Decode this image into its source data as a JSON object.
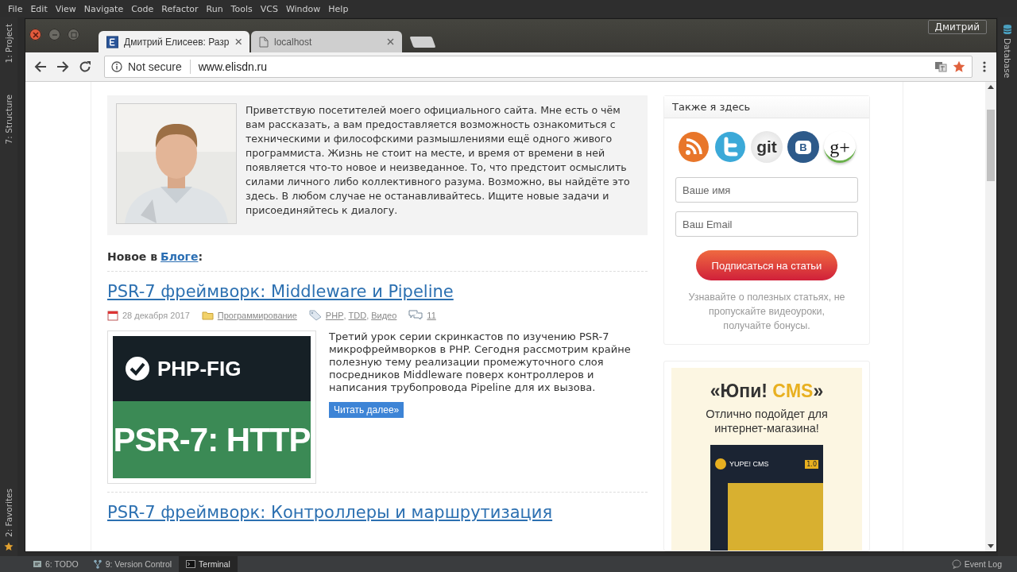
{
  "ide": {
    "menu": [
      "File",
      "Edit",
      "View",
      "Navigate",
      "Code",
      "Refactor",
      "Run",
      "Tools",
      "VCS",
      "Window",
      "Help"
    ],
    "left_tools": [
      {
        "label": "1: Project",
        "kind": "project"
      },
      {
        "label": "7: Structure",
        "kind": "structure"
      },
      {
        "label": "2: Favorites",
        "kind": "favorites"
      }
    ],
    "right_tools": [
      {
        "label": "Database"
      }
    ],
    "status_bar": [
      {
        "label": "6: TODO",
        "kind": "todo",
        "selected": false
      },
      {
        "label": "9: Version Control",
        "kind": "vcs",
        "selected": false
      },
      {
        "label": "Terminal",
        "kind": "terminal",
        "selected": true
      }
    ],
    "event_log": "Event Log"
  },
  "browser": {
    "profile": "Дмитрий",
    "tabs": [
      {
        "title": "Дмитрий Елисеев: Разр",
        "kind": "site",
        "selected": true
      },
      {
        "title": "localhost",
        "kind": "page",
        "selected": false
      }
    ],
    "security": "Not secure",
    "url": "www.elisdn.ru"
  },
  "page": {
    "intro": "Приветствую посетителей моего официального сайта. Мне есть о чём вам рассказать, а вам предоставляется возможность ознакомиться с техническими и философскими размышлениями ещё одного живого программиста. Жизнь не стоит на месте, и время от времени в ней появляется что-то новое и неизведанное. То, что предстоит осмыслить силами личного либо коллективного разума. Возможно, вы найдёте это здесь. В любом случае не останавливайтесь. Ищите новые задачи и присоединяйтесь к диалогу.",
    "news_label": "Новое в",
    "news_link": "Блоге",
    "news_colon": ":",
    "post": {
      "title": "PSR-7 фреймворк: Middleware и Pipeline",
      "date": "28 декабря 2017",
      "category": "Программирование",
      "tags": [
        "PHP",
        "TDD",
        "Видео"
      ],
      "tag_separator": ",",
      "comments": "11",
      "thumb_top": "PHP-FIG",
      "thumb_bottom": "PSR-7: HTTP",
      "excerpt": "Третий урок серии скринкастов по изучению PSR-7 микрофреймворков в PHP. Сегодня рассмотрим крайне полезную тему реализации промежуточного слоя посредников Middleware поверх контроллеров и написания трубопровода Pipeline для их вызова.",
      "more": "Читать далее»"
    },
    "next_title": "PSR-7 фреймворк: Контроллеры и маршрутизация"
  },
  "sidebar": {
    "title": "Также я здесь",
    "social": [
      {
        "kind": "rss"
      },
      {
        "kind": "twitter"
      },
      {
        "kind": "git",
        "label": "git"
      },
      {
        "kind": "vk",
        "label": "B"
      },
      {
        "kind": "gplus",
        "label": "g+"
      }
    ],
    "name_placeholder": "Ваше имя",
    "email_placeholder": "Ваш Email",
    "subscribe": "Подписаться на статьи",
    "note": "Узнавайте о полезных статьях, не пропускайте видеоуроки, получайте бонусы."
  },
  "ad": {
    "title_start": "«Юпи!",
    "title_accent": "CMS",
    "title_end": "»",
    "subtitle": "Отлично подойдет для интернет-магазина!",
    "box_brand": "YUPE! CMS",
    "box_version": "1.0"
  }
}
